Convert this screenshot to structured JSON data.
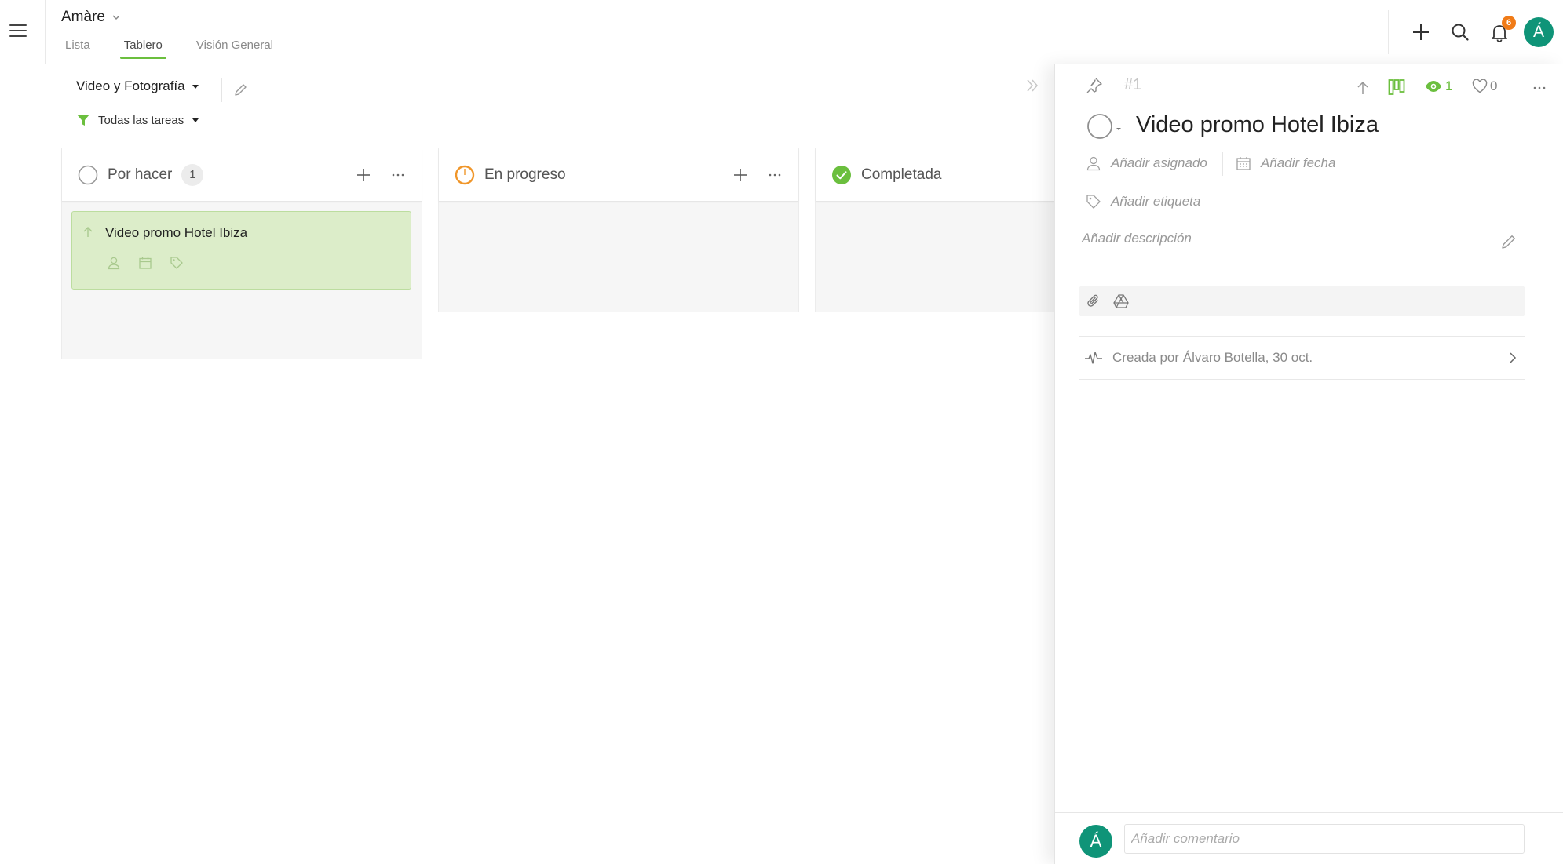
{
  "header": {
    "project_title": "Amàre",
    "tabs": [
      {
        "label": "Lista",
        "active": false
      },
      {
        "label": "Tablero",
        "active": true
      },
      {
        "label": "Visión General",
        "active": false
      }
    ],
    "notifications_count": "6",
    "user_initial": "Á",
    "icons": [
      "menu-icon",
      "chevron-down-icon",
      "plus-icon",
      "search-icon",
      "bell-icon"
    ]
  },
  "toolbar": {
    "view_name": "Video y Fotografía",
    "filter_label": "Todas las tareas"
  },
  "columns": [
    {
      "title": "Por hacer",
      "count": "1",
      "status": "todo"
    },
    {
      "title": "En progreso",
      "status": "in-progress"
    },
    {
      "title": "Completada",
      "status": "done"
    }
  ],
  "cards": [
    {
      "title": "Video promo Hotel Ibiza",
      "column": "Por hacer"
    }
  ],
  "detail": {
    "task_number": "#1",
    "title": "Video promo Hotel Ibiza",
    "watchers": "1",
    "likes": "0",
    "assignee_placeholder": "Añadir asignado",
    "date_placeholder": "Añadir fecha",
    "tag_placeholder": "Añadir etiqueta",
    "description_placeholder": "Añadir descripción",
    "activity_text": "Creada por Álvaro Botella, 30 oct.",
    "comment_placeholder": "Añadir comentario",
    "commenter_initial": "Á"
  },
  "colors": {
    "accent_green": "#6bbf3e",
    "card_green": "#dcedc9",
    "progress_orange": "#f0962a",
    "badge_orange": "#f07b17",
    "avatar_teal": "#0f9478"
  }
}
